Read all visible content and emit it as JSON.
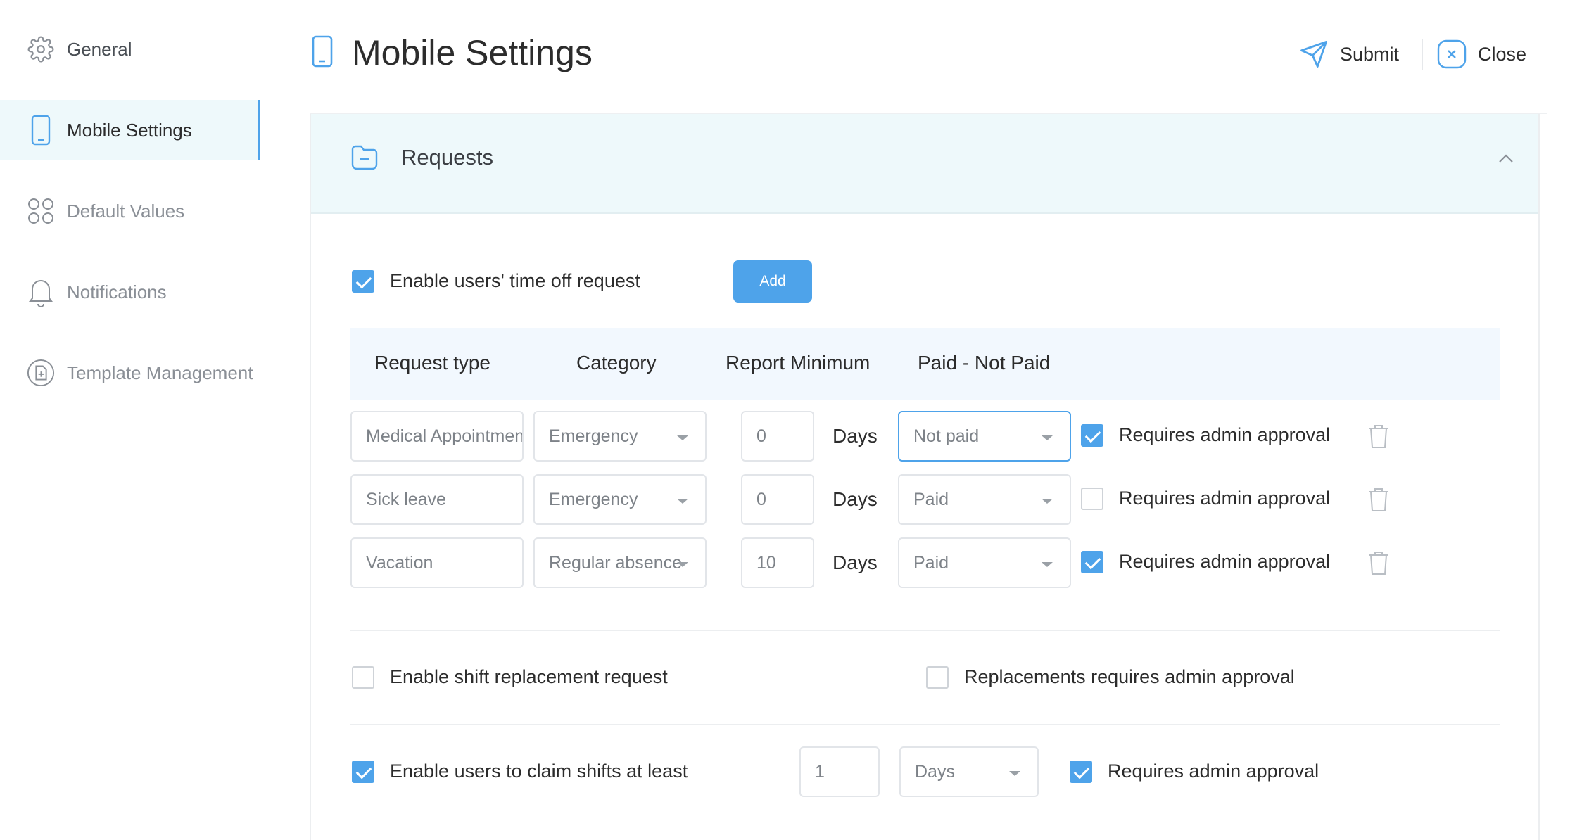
{
  "sidebar": {
    "items": [
      {
        "label": "General",
        "icon": "gear-icon"
      },
      {
        "label": "Mobile Settings",
        "icon": "mobile-phone-icon"
      },
      {
        "label": "Default Values",
        "icon": "grid-circles-icon"
      },
      {
        "label": "Notifications",
        "icon": "bell-icon"
      },
      {
        "label": "Template Management",
        "icon": "document-plus-icon"
      }
    ],
    "active_index": 1
  },
  "header": {
    "title": "Mobile Settings",
    "submit_label": "Submit",
    "close_label": "Close"
  },
  "requests": {
    "section_title": "Requests",
    "time_off": {
      "enabled": true,
      "label": "Enable users' time off request",
      "add_label": "Add"
    },
    "table": {
      "headers": [
        "Request type",
        "Category",
        "Report Minimum",
        "Paid - Not Paid"
      ],
      "rows": [
        {
          "type": "Medical Appointment",
          "category": "Emergency",
          "minimum": "0",
          "unit": "Days",
          "paid": "Not paid",
          "approval_checked": true,
          "approval_label": "Requires admin approval"
        },
        {
          "type": "Sick leave",
          "category": "Emergency",
          "minimum": "0",
          "unit": "Days",
          "paid": "Paid",
          "approval_checked": false,
          "approval_label": "Requires admin approval"
        },
        {
          "type": "Vacation",
          "category": "Regular absence",
          "minimum": "10",
          "unit": "Days",
          "paid": "Paid",
          "approval_checked": true,
          "approval_label": "Requires admin approval"
        }
      ]
    },
    "shift_replacement": {
      "enabled": false,
      "label": "Enable shift replacement request",
      "approval_checked": false,
      "approval_label": "Replacements requires admin approval"
    },
    "claim_shifts": {
      "enabled": true,
      "label": "Enable users to claim shifts at least",
      "value": "1",
      "unit": "Days",
      "approval_checked": true,
      "approval_label": "Requires admin approval"
    }
  },
  "colors": {
    "accent": "#4ea3ea",
    "active_bg": "#eef9fb",
    "table_header_bg": "#f2f8fe"
  }
}
